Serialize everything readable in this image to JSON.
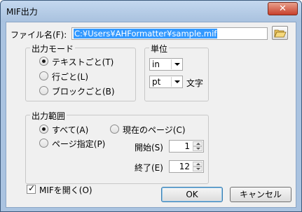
{
  "window": {
    "title": "MIF出力",
    "close_glyph": "✕"
  },
  "file": {
    "label": "ファイル名(F):",
    "path": "C:¥Users¥AHFormatter¥sample.mif"
  },
  "output_mode": {
    "title": "出力モード",
    "options": [
      {
        "label": "テキストごと(T)",
        "selected": true
      },
      {
        "label": "行ごと(L)",
        "selected": false
      },
      {
        "label": "ブロックごと(B)",
        "selected": false
      }
    ]
  },
  "unit": {
    "title": "単位",
    "unit_value": "in",
    "size_value": "pt",
    "size_suffix": "文字"
  },
  "output_range": {
    "title": "出力範囲",
    "all_label": "すべて(A)",
    "all_selected": true,
    "current_label": "現在のページ(C)",
    "current_selected": false,
    "specified_label": "ページ指定(P)",
    "specified_selected": false,
    "start_label": "開始(S)",
    "start_value": "1",
    "end_label": "終了(E)",
    "end_value": "12"
  },
  "open_mif": {
    "label": "MIFを開く(O)",
    "checked": true
  },
  "buttons": {
    "ok": "OK",
    "cancel": "キャンセル"
  },
  "icons": {
    "folder": "folder-open-icon"
  }
}
